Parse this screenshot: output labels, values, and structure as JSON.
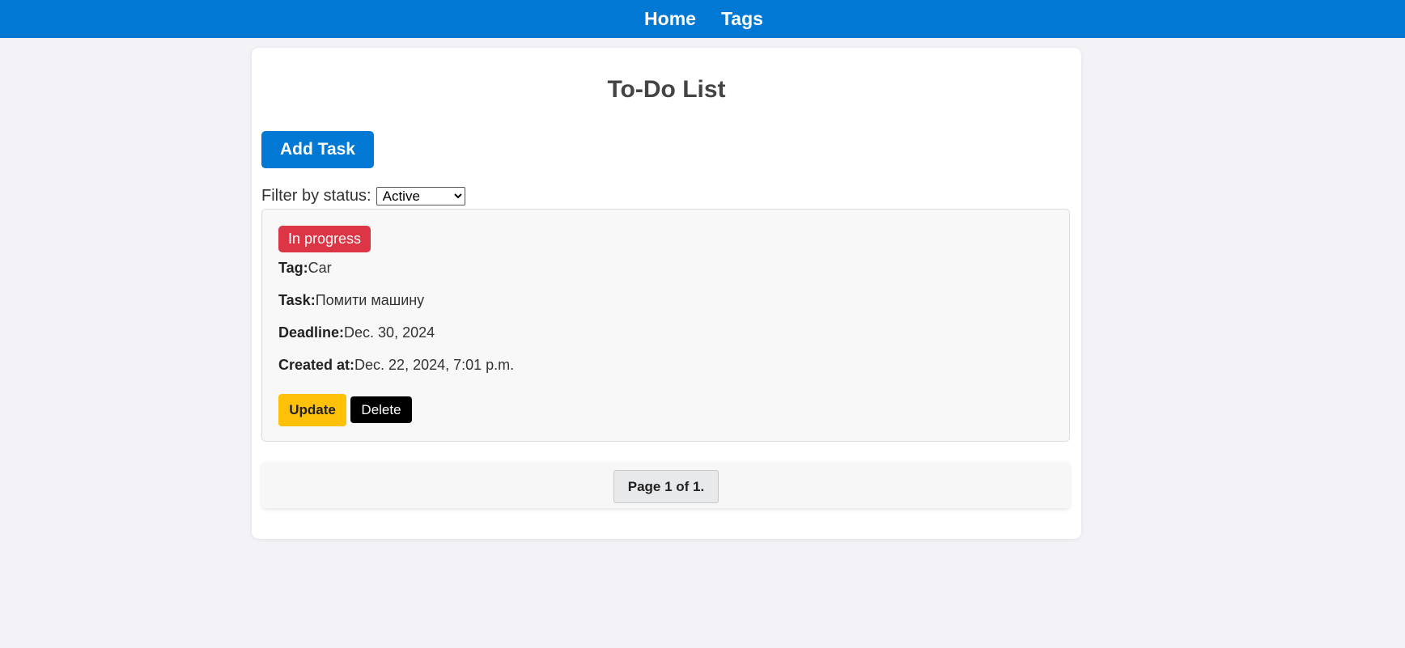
{
  "nav": {
    "home_label": "Home",
    "tags_label": "Tags"
  },
  "page": {
    "title": "To-Do List",
    "add_task_label": "Add Task"
  },
  "filter": {
    "label": "Filter by status:",
    "selected": "Active"
  },
  "tasks": [
    {
      "status": "In progress",
      "status_color": "#dc3545",
      "tag_label": "Tag:",
      "tag": "Car",
      "task_label": "Task:",
      "task": "Помити машину",
      "deadline_label": "Deadline:",
      "deadline": "Dec. 30, 2024",
      "created_label": "Created at:",
      "created_at": "Dec. 22, 2024, 7:01 p.m.",
      "update_label": "Update",
      "delete_label": "Delete"
    }
  ],
  "pagination": {
    "text": "Page 1 of 1."
  },
  "colors": {
    "primary": "#0078d4",
    "update": "#ffc107",
    "delete": "#000000",
    "background": "#f3f3f7"
  }
}
